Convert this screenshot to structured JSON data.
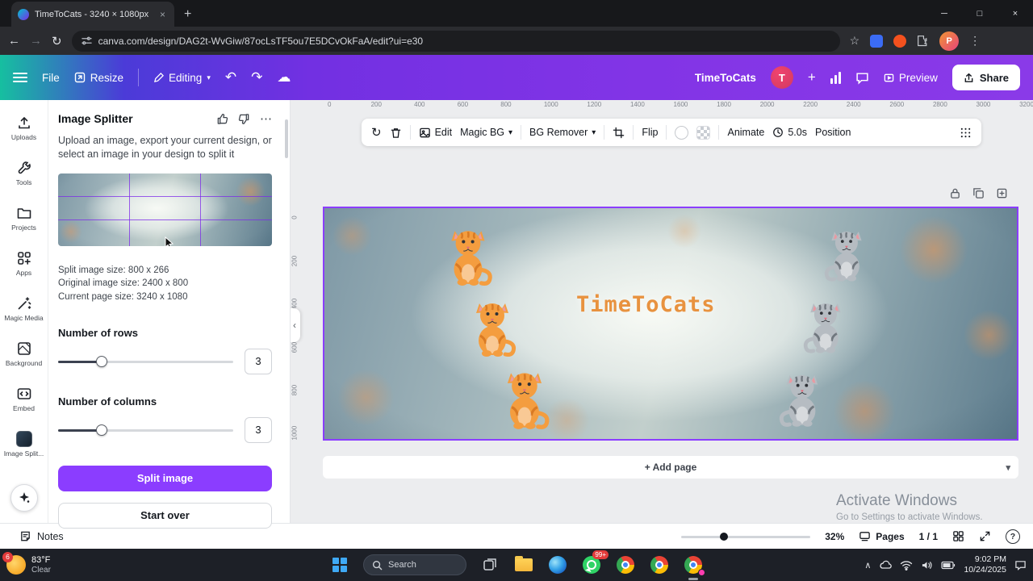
{
  "browser": {
    "tab": {
      "title": "TimeToCats - 3240 × 1080px"
    },
    "url": "canva.com/design/DAG2t-WvGiw/87ocLsTF5ou7E5DCvOkFaA/edit?ui=e30",
    "profile_initial": "P"
  },
  "icons": {
    "back": "←",
    "forward": "→",
    "reload": "↻",
    "minimize": "─",
    "maximize": "□",
    "close": "×",
    "tab_close": "×",
    "new_tab": "+",
    "star": "☆",
    "menu_kebab": "⋮",
    "menu_ellipsis": "⋯",
    "undo": "↶",
    "redo": "↷",
    "cloud": "☁",
    "chevron_down": "▾",
    "collapse": "‹",
    "plus": "+",
    "tray_chevron": "∧",
    "help": "?"
  },
  "header": {
    "menu_items": {
      "file": "File",
      "resize": "Resize",
      "editing": "Editing"
    },
    "doc_title": "TimeToCats",
    "avatar_initial": "T",
    "preview_label": "Preview",
    "share_label": "Share"
  },
  "rail": {
    "items": [
      {
        "label": "Uploads"
      },
      {
        "label": "Tools"
      },
      {
        "label": "Projects"
      },
      {
        "label": "Apps"
      },
      {
        "label": "Magic Media"
      },
      {
        "label": "Background"
      },
      {
        "label": "Embed"
      },
      {
        "label": "Image Split..."
      }
    ]
  },
  "panel": {
    "title": "Image Splitter",
    "description": "Upload an image, export your current design, or select an image in your design to split it",
    "info_lines": [
      "Split image size: 800 x 266",
      "Original image size: 2400 x 800",
      "Current page size: 3240 x 1080"
    ],
    "rows": {
      "label": "Number of rows",
      "value": "3"
    },
    "columns": {
      "label": "Number of columns",
      "value": "3"
    },
    "split_button": "Split image",
    "start_over_button": "Start over"
  },
  "context_toolbar": {
    "edit": "Edit",
    "magic_bg": "Magic BG",
    "bg_remover": "BG Remover",
    "flip": "Flip",
    "animate": "Animate",
    "duration": "5.0s",
    "position": "Position"
  },
  "rulers": {
    "horizontal": [
      "0",
      "200",
      "400",
      "600",
      "800",
      "1000",
      "1200",
      "1400",
      "1600",
      "1800",
      "2000",
      "2200",
      "2400",
      "2600",
      "2800",
      "3000",
      "3200"
    ],
    "vertical": [
      "0",
      "200",
      "400",
      "600",
      "800",
      "1000"
    ]
  },
  "design": {
    "title_text": "TimeToCats",
    "title_color": "#e8923f",
    "cat_orange": "#f49d3f",
    "cat_orange_stripe": "#d97a24",
    "cat_gray": "#b6bcc2",
    "cat_gray_stripe": "#70777e",
    "add_page_label": "+ Add page"
  },
  "watermark": {
    "line1": "Activate Windows",
    "line2": "Go to Settings to activate Windows."
  },
  "statusbar": {
    "notes": "Notes",
    "zoom": "32%",
    "pages_label": "Pages",
    "page_count": "1 / 1"
  },
  "taskbar": {
    "weather": {
      "temp": "83°F",
      "condition": "Clear",
      "badge": "6"
    },
    "search": "Search",
    "whatsapp_badge": "99+",
    "clock": {
      "time": "9:02 PM",
      "date": "10/24/2025"
    }
  },
  "colors": {
    "accent": "#8b3dff",
    "header_gradient_start": "#00c4cc",
    "header_gradient_end": "#7d2ae8"
  }
}
